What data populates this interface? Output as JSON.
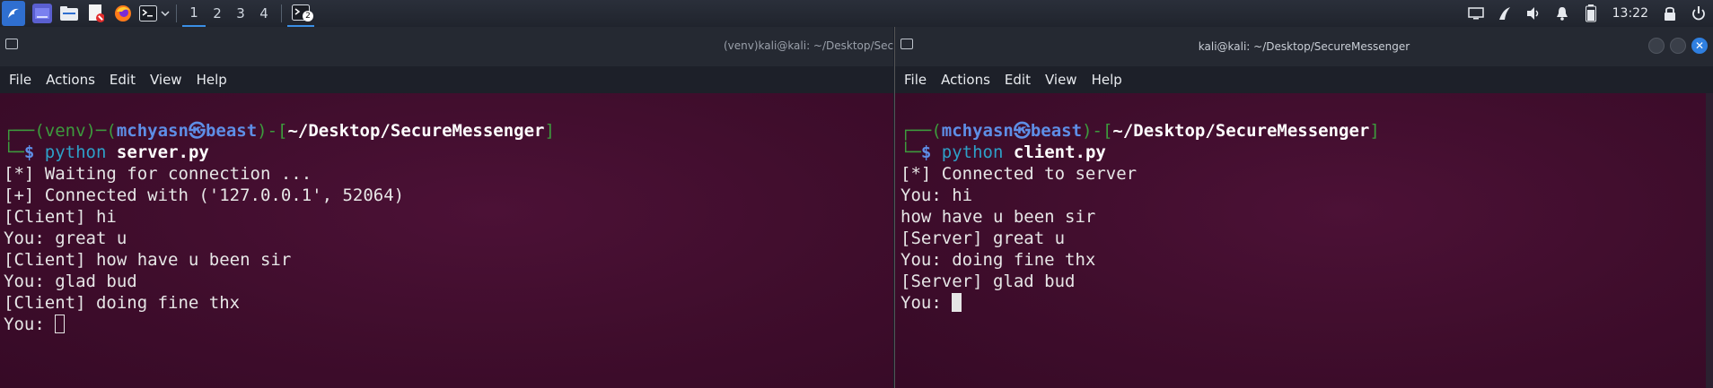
{
  "panel": {
    "workspaces": [
      "1",
      "2",
      "3",
      "4"
    ],
    "active_workspace": "1",
    "terminal_badge": "2",
    "clock": "13:22",
    "icons": [
      "kali-menu-icon",
      "desktop-icon",
      "files-icon",
      "text-editor-icon",
      "firefox-icon",
      "terminal-icon",
      "terminal-dropdown-icon",
      "terminal-task-icon",
      "monitor-icon",
      "network-icon",
      "volume-icon",
      "notifications-icon",
      "battery-icon",
      "lock-icon",
      "power-icon"
    ]
  },
  "left_window": {
    "title": "(venv)kali@kali: ~/Desktop/Secure",
    "menu": [
      "File",
      "Actions",
      "Edit",
      "View",
      "Help"
    ],
    "prompt": {
      "corner_top": "┌──(",
      "venv": "venv",
      "sep1": ")─(",
      "user": "mchyasn",
      "at": "㉿",
      "host": "beast",
      "sep2": ")-[",
      "path": "~/Desktop/SecureMessenger",
      "close": "]",
      "corner_bottom": "└─",
      "dollar": "$ ",
      "cmd": "python",
      "arg": "server.py"
    },
    "lines": [
      "[*] Waiting for connection ...",
      "[+] Connected with ('127.0.0.1', 52064)",
      "[Client] hi",
      "You: great u",
      "[Client] how have u been sir",
      "You: glad bud",
      "[Client] doing fine thx"
    ],
    "input_prompt": "You: "
  },
  "right_window": {
    "title": "kali@kali: ~/Desktop/SecureMessenger",
    "menu": [
      "File",
      "Actions",
      "Edit",
      "View",
      "Help"
    ],
    "prompt": {
      "corner_top": "┌──(",
      "user": "mchyasn",
      "at": "㉿",
      "host": "beast",
      "sep2": ")-[",
      "path": "~/Desktop/SecureMessenger",
      "close": "]",
      "corner_bottom": "└─",
      "dollar": "$ ",
      "cmd": "python",
      "arg": "client.py"
    },
    "lines": [
      "[*] Connected to server",
      "You: hi",
      "how have u been sir",
      "[Server] great u",
      "You: doing fine thx",
      "[Server] glad bud"
    ],
    "input_prompt": "You: "
  }
}
